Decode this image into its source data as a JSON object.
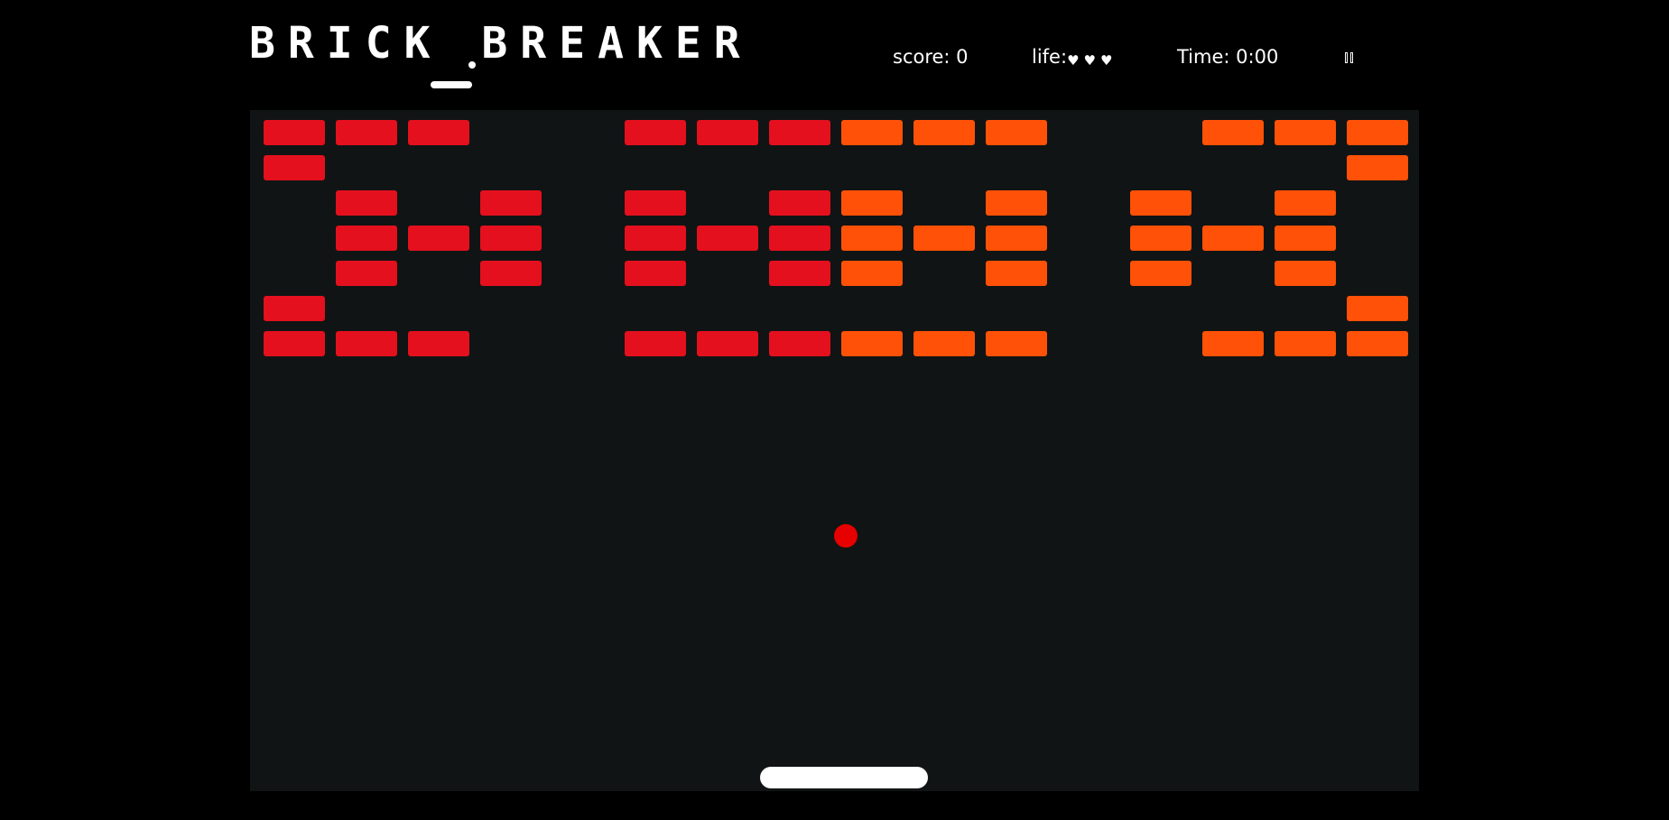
{
  "header": {
    "title": "BRICK BREAKER"
  },
  "hud": {
    "score_label": "score: 0",
    "life_label": "life:",
    "lives": 3,
    "hearts": "♥♥♥",
    "time_label": "Time: 0:00",
    "pause_icon": "pause-icon"
  },
  "game": {
    "colors": {
      "background": "#000000",
      "board": "#111414",
      "red_brick": "#E4101E",
      "orange_brick": "#FF5107",
      "ball": "#E60000",
      "paddle": "#FFFFFF"
    },
    "brick_grid": {
      "columns": 16,
      "rows": 7,
      "bricks": [
        {
          "row": 0,
          "col": 0,
          "color": "red"
        },
        {
          "row": 0,
          "col": 1,
          "color": "red"
        },
        {
          "row": 0,
          "col": 2,
          "color": "red"
        },
        {
          "row": 0,
          "col": 5,
          "color": "red"
        },
        {
          "row": 0,
          "col": 6,
          "color": "red"
        },
        {
          "row": 0,
          "col": 7,
          "color": "red"
        },
        {
          "row": 0,
          "col": 8,
          "color": "orange"
        },
        {
          "row": 0,
          "col": 9,
          "color": "orange"
        },
        {
          "row": 0,
          "col": 10,
          "color": "orange"
        },
        {
          "row": 0,
          "col": 13,
          "color": "orange"
        },
        {
          "row": 0,
          "col": 14,
          "color": "orange"
        },
        {
          "row": 0,
          "col": 15,
          "color": "orange"
        },
        {
          "row": 1,
          "col": 0,
          "color": "red"
        },
        {
          "row": 1,
          "col": 15,
          "color": "orange"
        },
        {
          "row": 2,
          "col": 1,
          "color": "red"
        },
        {
          "row": 2,
          "col": 3,
          "color": "red"
        },
        {
          "row": 2,
          "col": 5,
          "color": "red"
        },
        {
          "row": 2,
          "col": 7,
          "color": "red"
        },
        {
          "row": 2,
          "col": 8,
          "color": "orange"
        },
        {
          "row": 2,
          "col": 10,
          "color": "orange"
        },
        {
          "row": 2,
          "col": 12,
          "color": "orange"
        },
        {
          "row": 2,
          "col": 14,
          "color": "orange"
        },
        {
          "row": 3,
          "col": 1,
          "color": "red"
        },
        {
          "row": 3,
          "col": 2,
          "color": "red"
        },
        {
          "row": 3,
          "col": 3,
          "color": "red"
        },
        {
          "row": 3,
          "col": 5,
          "color": "red"
        },
        {
          "row": 3,
          "col": 6,
          "color": "red"
        },
        {
          "row": 3,
          "col": 7,
          "color": "red"
        },
        {
          "row": 3,
          "col": 8,
          "color": "orange"
        },
        {
          "row": 3,
          "col": 9,
          "color": "orange"
        },
        {
          "row": 3,
          "col": 10,
          "color": "orange"
        },
        {
          "row": 3,
          "col": 12,
          "color": "orange"
        },
        {
          "row": 3,
          "col": 13,
          "color": "orange"
        },
        {
          "row": 3,
          "col": 14,
          "color": "orange"
        },
        {
          "row": 4,
          "col": 1,
          "color": "red"
        },
        {
          "row": 4,
          "col": 3,
          "color": "red"
        },
        {
          "row": 4,
          "col": 5,
          "color": "red"
        },
        {
          "row": 4,
          "col": 7,
          "color": "red"
        },
        {
          "row": 4,
          "col": 8,
          "color": "orange"
        },
        {
          "row": 4,
          "col": 10,
          "color": "orange"
        },
        {
          "row": 4,
          "col": 12,
          "color": "orange"
        },
        {
          "row": 4,
          "col": 14,
          "color": "orange"
        },
        {
          "row": 5,
          "col": 0,
          "color": "red"
        },
        {
          "row": 5,
          "col": 15,
          "color": "orange"
        },
        {
          "row": 6,
          "col": 0,
          "color": "red"
        },
        {
          "row": 6,
          "col": 1,
          "color": "red"
        },
        {
          "row": 6,
          "col": 2,
          "color": "red"
        },
        {
          "row": 6,
          "col": 5,
          "color": "red"
        },
        {
          "row": 6,
          "col": 6,
          "color": "red"
        },
        {
          "row": 6,
          "col": 7,
          "color": "red"
        },
        {
          "row": 6,
          "col": 8,
          "color": "orange"
        },
        {
          "row": 6,
          "col": 9,
          "color": "orange"
        },
        {
          "row": 6,
          "col": 10,
          "color": "orange"
        },
        {
          "row": 6,
          "col": 13,
          "color": "orange"
        },
        {
          "row": 6,
          "col": 14,
          "color": "orange"
        },
        {
          "row": 6,
          "col": 15,
          "color": "orange"
        }
      ]
    }
  }
}
